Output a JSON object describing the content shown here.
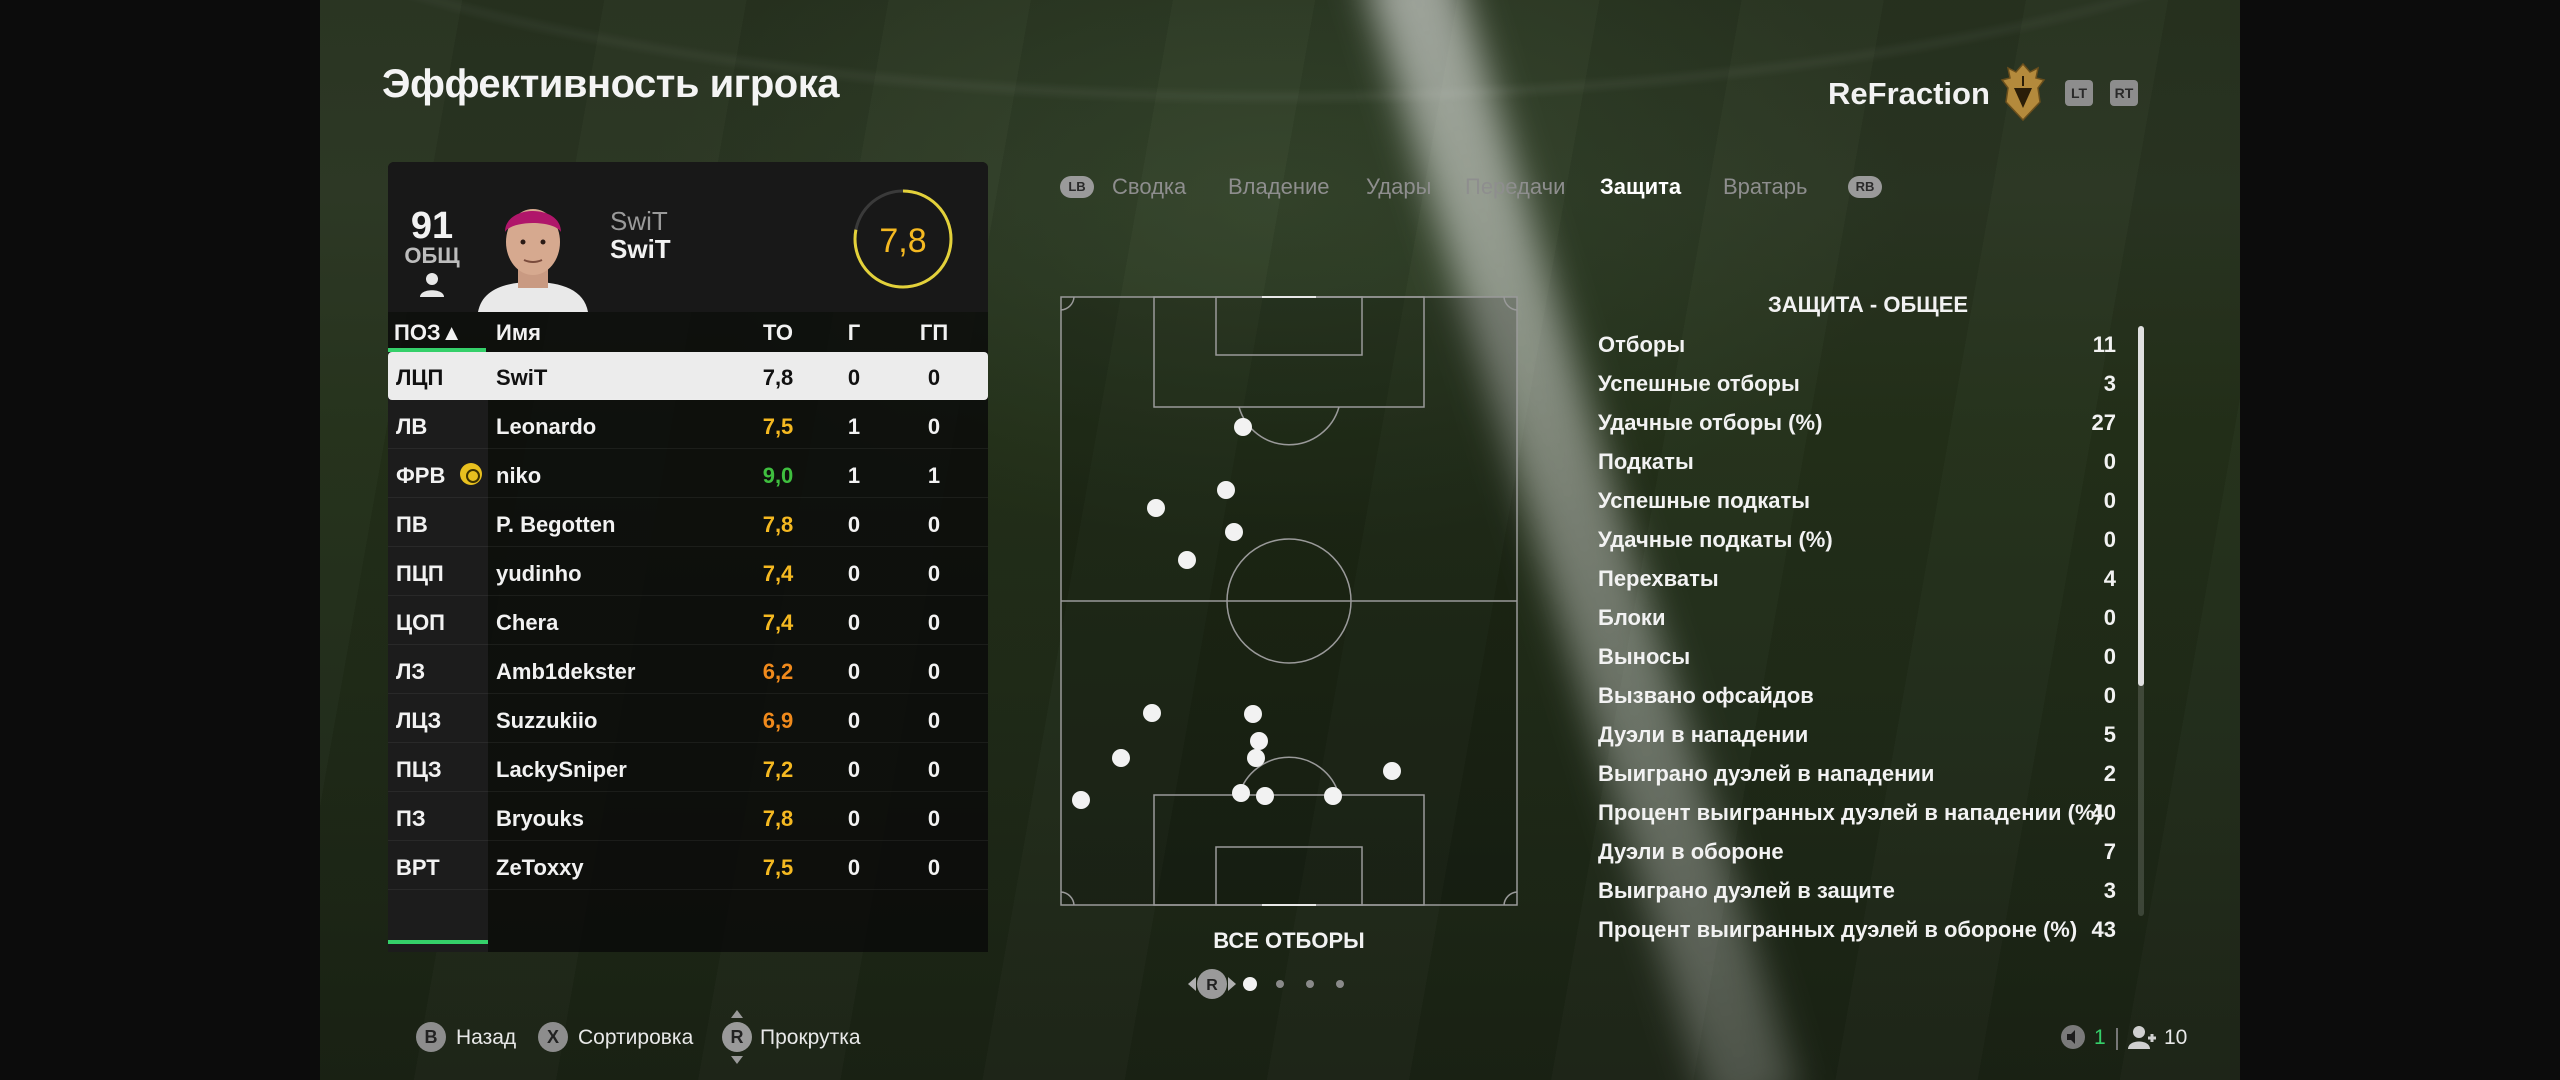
{
  "header": {
    "title": "Эффективность игрока",
    "club": "ReFraction",
    "lt": "LT",
    "rt": "RT"
  },
  "player": {
    "ovr": "91",
    "ovr_label": "ОБЩ",
    "name_top": "SwiT",
    "name_bottom": "SwiT",
    "rating": "7,8"
  },
  "table": {
    "headers": {
      "pos": "ПОЗ▲",
      "name": "Имя",
      "to": "ТО",
      "g": "Г",
      "gp": "ГП"
    },
    "rows": [
      {
        "pos": "ЛЦП",
        "name": "SwiT",
        "to": "7,8",
        "g": "0",
        "gp": "0",
        "color": "#111111"
      },
      {
        "pos": "ЛВ",
        "name": "Leonardo",
        "to": "7,5",
        "g": "1",
        "gp": "0",
        "color": "#f5b921"
      },
      {
        "pos": "ФРВ",
        "name": "niko",
        "to": "9,0",
        "g": "1",
        "gp": "1",
        "color": "#3fbf3f"
      },
      {
        "pos": "ПВ",
        "name": "P. Begotten",
        "to": "7,8",
        "g": "0",
        "gp": "0",
        "color": "#f5b921"
      },
      {
        "pos": "ПЦП",
        "name": "yudinho",
        "to": "7,4",
        "g": "0",
        "gp": "0",
        "color": "#f5b921"
      },
      {
        "pos": "ЦОП",
        "name": "Chera",
        "to": "7,4",
        "g": "0",
        "gp": "0",
        "color": "#f5b921"
      },
      {
        "pos": "ЛЗ",
        "name": "Amb1dekster",
        "to": "6,2",
        "g": "0",
        "gp": "0",
        "color": "#f08a1c"
      },
      {
        "pos": "ЛЦЗ",
        "name": "Suzzukiio",
        "to": "6,9",
        "g": "0",
        "gp": "0",
        "color": "#f08a1c"
      },
      {
        "pos": "ПЦЗ",
        "name": "LackySniper",
        "to": "7,2",
        "g": "0",
        "gp": "0",
        "color": "#f5b921"
      },
      {
        "pos": "ПЗ",
        "name": "Bryouks",
        "to": "7,8",
        "g": "0",
        "gp": "0",
        "color": "#f5b921"
      },
      {
        "pos": "ВРТ",
        "name": "ZeToxxy",
        "to": "7,5",
        "g": "0",
        "gp": "0",
        "color": "#f5b921"
      }
    ]
  },
  "tabs": {
    "lb": "LB",
    "rb": "RB",
    "items": [
      "Сводка",
      "Владение",
      "Удары",
      "Передачи",
      "Защита",
      "Вратарь"
    ],
    "active": 4
  },
  "pitch": {
    "caption": "ВСЕ ОТБОРЫ",
    "pager_button": "R",
    "pages": 4,
    "current_page": 0
  },
  "stats": {
    "title": "ЗАЩИТА - ОБЩЕЕ",
    "items": [
      {
        "label": "Отборы",
        "value": "11"
      },
      {
        "label": "Успешные отборы",
        "value": "3"
      },
      {
        "label": "Удачные отборы (%)",
        "value": "27"
      },
      {
        "label": "Подкаты",
        "value": "0"
      },
      {
        "label": "Успешные подкаты",
        "value": "0"
      },
      {
        "label": "Удачные подкаты (%)",
        "value": "0"
      },
      {
        "label": "Перехваты",
        "value": "4"
      },
      {
        "label": "Блоки",
        "value": "0"
      },
      {
        "label": "Выносы",
        "value": "0"
      },
      {
        "label": "Вызвано офсайдов",
        "value": "0"
      },
      {
        "label": "Дуэли в нападении",
        "value": "5"
      },
      {
        "label": "Выиграно дуэлей в нападении",
        "value": "2"
      },
      {
        "label": "Процент выигранных дуэлей в нападении (%)",
        "value": "40"
      },
      {
        "label": "Дуэли в обороне",
        "value": "7"
      },
      {
        "label": "Выиграно дуэлей в защите",
        "value": "3"
      },
      {
        "label": "Процент выигранных дуэлей в обороне (%)",
        "value": "43"
      }
    ]
  },
  "footer": {
    "back_btn": "B",
    "back": "Назад",
    "sort_btn": "X",
    "sort": "Сортировка",
    "scroll_btn": "R",
    "scroll": "Прокрутка",
    "mic_count": "1",
    "players_count": "10"
  },
  "colors": {
    "accent": "#35d06a",
    "rating": "#f5b921"
  }
}
